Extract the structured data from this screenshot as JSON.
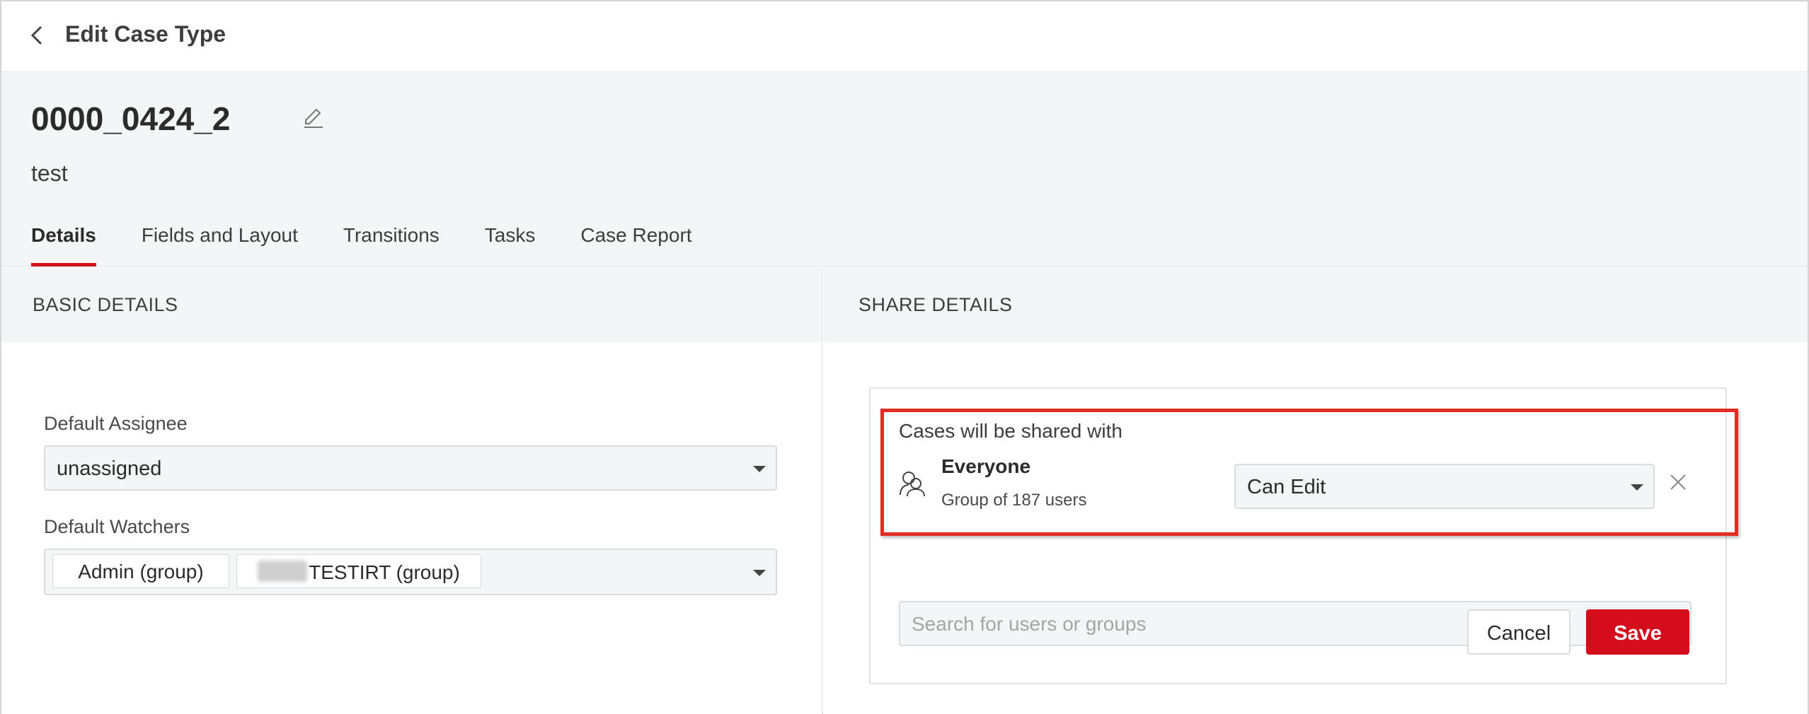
{
  "topbar": {
    "title": "Edit Case Type"
  },
  "case_type": {
    "name": "0000_0424_2",
    "description": "test"
  },
  "tabs": [
    {
      "label": "Details",
      "active": true
    },
    {
      "label": "Fields and Layout",
      "active": false
    },
    {
      "label": "Transitions",
      "active": false
    },
    {
      "label": "Tasks",
      "active": false
    },
    {
      "label": "Case Report",
      "active": false
    }
  ],
  "basic_details": {
    "heading": "BASIC DETAILS",
    "default_assignee": {
      "label": "Default Assignee",
      "value": "unassigned"
    },
    "default_watchers": {
      "label": "Default Watchers",
      "chips": [
        "Admin (group)",
        "TESTIRT (group)"
      ]
    }
  },
  "share_details": {
    "heading": "SHARE DETAILS",
    "shared_with_label": "Cases will be shared with",
    "shares": [
      {
        "name": "Everyone",
        "subtitle": "Group of 187 users",
        "permission": "Can Edit"
      }
    ],
    "search_placeholder": "Search for users or groups",
    "cancel_label": "Cancel",
    "save_label": "Save"
  },
  "colors": {
    "accent": "#d50c1c",
    "highlight_border": "#e02c22",
    "band_bg": "#f4f5f7"
  }
}
